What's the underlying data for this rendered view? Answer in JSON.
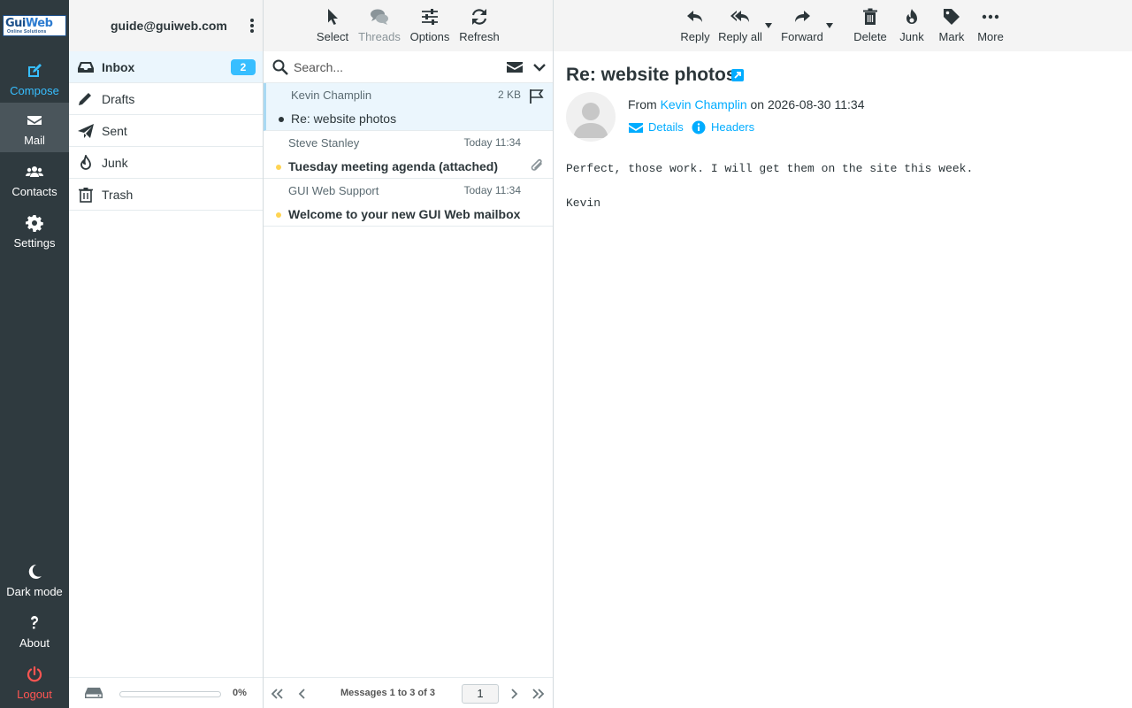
{
  "app": {
    "logo_text_a": "Gui",
    "logo_text_b": "Web",
    "logo_tagline": "Online Solutions"
  },
  "nav": {
    "compose": "Compose",
    "mail": "Mail",
    "contacts": "Contacts",
    "settings": "Settings",
    "dark_mode": "Dark mode",
    "about": "About",
    "logout": "Logout"
  },
  "account": {
    "email": "guide@guiweb.com"
  },
  "folders": [
    {
      "label": "Inbox",
      "unread": "2"
    },
    {
      "label": "Drafts"
    },
    {
      "label": "Sent"
    },
    {
      "label": "Junk"
    },
    {
      "label": "Trash"
    }
  ],
  "quota": {
    "percent_label": "0%",
    "percent": 0
  },
  "list_toolbar": {
    "select": "Select",
    "threads": "Threads",
    "options": "Options",
    "refresh": "Refresh"
  },
  "search": {
    "placeholder": "Search..."
  },
  "messages": [
    {
      "from": "Kevin Champlin",
      "meta": "2 KB",
      "subject": "Re: website photos"
    },
    {
      "from": "Steve Stanley",
      "meta": "Today 11:34",
      "subject": "Tuesday meeting agenda (attached)"
    },
    {
      "from": "GUI Web Support",
      "meta": "Today 11:34",
      "subject": "Welcome to your new GUI Web mailbox"
    }
  ],
  "pager": {
    "count_label": "Messages 1 to 3 of 3",
    "page": "1"
  },
  "view_toolbar": {
    "reply": "Reply",
    "reply_all": "Reply all",
    "forward": "Forward",
    "delete": "Delete",
    "junk": "Junk",
    "mark": "Mark",
    "more": "More"
  },
  "message": {
    "subject": "Re: website photos",
    "from_prefix": "From",
    "from_name": "Kevin Champlin",
    "date_text": "on 2026-08-30 11:34",
    "details": "Details",
    "headers": "Headers",
    "body": [
      "Perfect, those work. I will get them on the site this week.",
      "Kevin"
    ]
  },
  "colors": {
    "nav_bg": "#2f3a3f",
    "accent": "#37beff",
    "link": "#00acff",
    "logout": "#ff5552",
    "selected_bg": "#ebf6fd",
    "unread_dot": "#ffd452"
  }
}
